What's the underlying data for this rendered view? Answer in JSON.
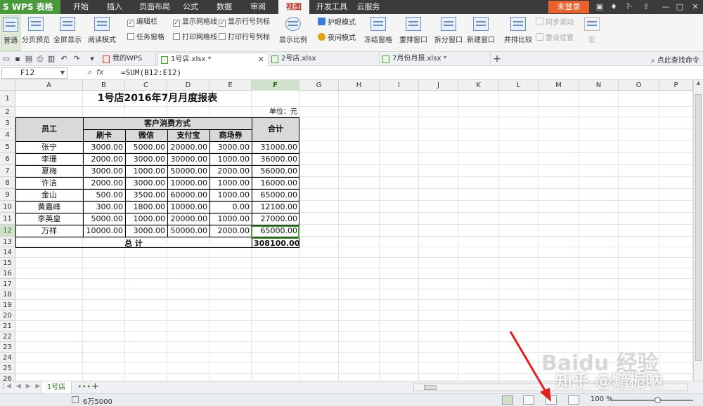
{
  "app": {
    "logo": "S WPS 表格",
    "login": "未登录"
  },
  "menu": [
    "开始",
    "插入",
    "页面布局",
    "公式",
    "数据",
    "审阅",
    "视图",
    "开发工具",
    "云服务"
  ],
  "ribbon": {
    "buttons": [
      "普通",
      "分页预览",
      "全屏显示",
      "阅读模式",
      "显示比例",
      "冻结窗格",
      "重排窗口",
      "拆分窗口",
      "新建窗口",
      "并排比较"
    ],
    "checks": {
      "edit_bar": "编辑栏",
      "task_pane": "任务窗格",
      "show_grid": "显示网格线",
      "print_grid": "打印网格线",
      "show_headers": "显示行号列标",
      "print_headers": "打印行号列标"
    },
    "eye_mode": "护眼模式",
    "night_mode": "夜间模式",
    "sync_scroll": "同步滚动",
    "reset_pos": "重设位置",
    "macro": "宏"
  },
  "tabs": {
    "mywps": "我的WPS",
    "t1": "1号店.xlsx *",
    "t2": "2号店.xlsx",
    "t3": "7月份月报.xlsx *",
    "search": "点此查找命令"
  },
  "formula_bar": {
    "name": "F12",
    "fx": "fx",
    "formula": "=SUM(B12:E12)"
  },
  "columns": [
    "A",
    "B",
    "C",
    "D",
    "E",
    "F",
    "G",
    "H",
    "I",
    "J",
    "K",
    "L",
    "M",
    "N",
    "O",
    "P"
  ],
  "rows": [
    "1",
    "2",
    "3",
    "4",
    "5",
    "6",
    "7",
    "8",
    "9",
    "10",
    "11",
    "12",
    "13",
    "14",
    "15",
    "16",
    "17",
    "18",
    "19",
    "20",
    "21",
    "22",
    "23",
    "24",
    "25",
    "26"
  ],
  "sheet": {
    "title": "1号店2016年7月月度报表",
    "unit": "单位：元",
    "h_employee": "员工",
    "h_payment": "客户消费方式",
    "h_total": "合计",
    "h_methods": [
      "刷卡",
      "微信",
      "支付宝",
      "商场券"
    ],
    "data": [
      [
        "张宁",
        "3000.00",
        "5000.00",
        "20000.00",
        "3000.00",
        "31000.00"
      ],
      [
        "李珊",
        "2000.00",
        "3000.00",
        "30000.00",
        "1000.00",
        "36000.00"
      ],
      [
        "夏梅",
        "3000.00",
        "1000.00",
        "50000.00",
        "2000.00",
        "56000.00"
      ],
      [
        "许洁",
        "2000.00",
        "3000.00",
        "10000.00",
        "1000.00",
        "16000.00"
      ],
      [
        "金山",
        "500.00",
        "3500.00",
        "60000.00",
        "1000.00",
        "65000.00"
      ],
      [
        "黄嘉峰",
        "300.00",
        "1800.00",
        "10000.00",
        "0.00",
        "12100.00"
      ],
      [
        "李英皇",
        "5000.00",
        "1000.00",
        "20000.00",
        "1000.00",
        "27000.00"
      ],
      [
        "万祥",
        "10000.00",
        "3000.00",
        "50000.00",
        "2000.00",
        "65000.00"
      ]
    ],
    "grand_label": "总 计",
    "grand_total": "308100.00"
  },
  "sheet_tab": "1号店",
  "status": {
    "sum": "6万5000",
    "zoom": "100 %"
  },
  "watermark": "知乎 @黯栀吶",
  "watermark2": "Baidu 经验"
}
